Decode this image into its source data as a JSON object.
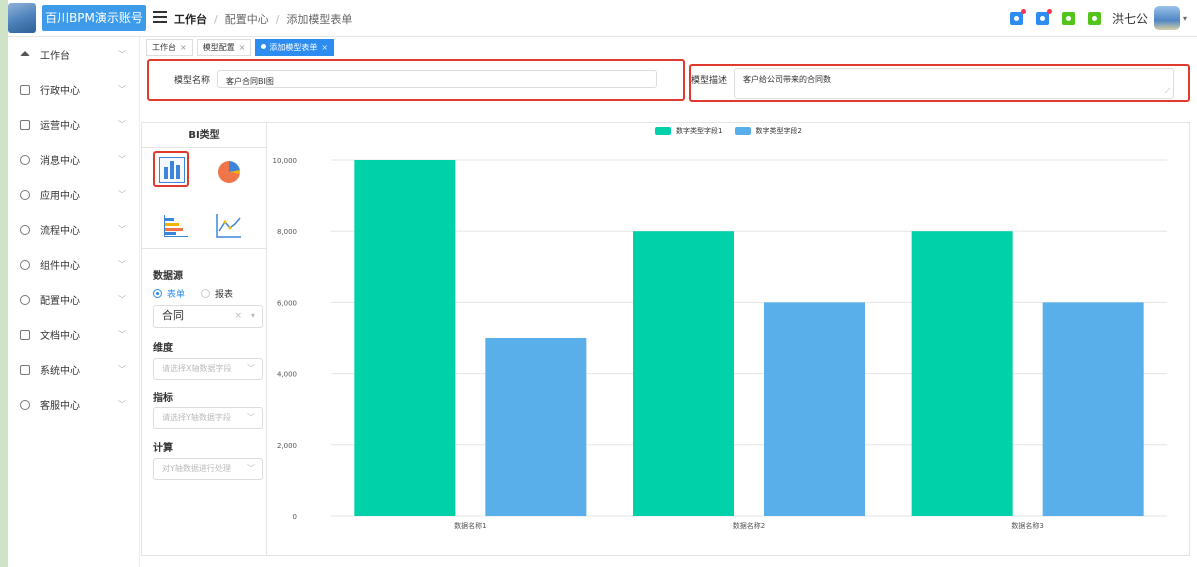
{
  "header": {
    "app_title": "百川BPM演示账号",
    "breadcrumb": [
      "工作台",
      "配置中心",
      "添加模型表单"
    ],
    "user_name": "洪七公",
    "icons": [
      {
        "name": "notice-icon",
        "color": "#2d8cf0",
        "badge": true
      },
      {
        "name": "bell-icon",
        "color": "#2d8cf0",
        "badge": true
      },
      {
        "name": "message-icon",
        "color": "#52c41a",
        "badge": false
      },
      {
        "name": "lock-icon",
        "color": "#52c41a",
        "badge": false
      }
    ]
  },
  "sidebar": {
    "items": [
      {
        "label": "工作台",
        "icon": "home-icon"
      },
      {
        "label": "行政中心",
        "icon": "building-icon"
      },
      {
        "label": "运营中心",
        "icon": "monitor-icon"
      },
      {
        "label": "消息中心",
        "icon": "bell-icon"
      },
      {
        "label": "应用中心",
        "icon": "apps-icon"
      },
      {
        "label": "流程中心",
        "icon": "share-icon"
      },
      {
        "label": "组件中心",
        "icon": "component-icon"
      },
      {
        "label": "配置中心",
        "icon": "gear-icon"
      },
      {
        "label": "文档中心",
        "icon": "folder-icon"
      },
      {
        "label": "系统中心",
        "icon": "desktop-icon"
      },
      {
        "label": "客服中心",
        "icon": "user-icon"
      }
    ]
  },
  "tabs": [
    {
      "label": "工作台",
      "active": false
    },
    {
      "label": "模型配置",
      "active": false
    },
    {
      "label": "添加模型表单",
      "active": true
    }
  ],
  "form": {
    "name_label": "模型名称",
    "name_value": "客户合同BI图",
    "desc_label": "模型描述",
    "desc_value": "客户给公司带来的合同数"
  },
  "bi_panel": {
    "title": "BI类型",
    "chart_types": [
      "bar-chart-icon",
      "pie-chart-icon",
      "horizontal-bar-icon",
      "line-chart-icon"
    ],
    "datasource_label": "数据源",
    "datasource_options": [
      "表单",
      "报表"
    ],
    "datasource_selected": "表单",
    "datasource_value": "合同",
    "dimension_label": "维度",
    "dimension_placeholder": "请选择X轴数据字段",
    "metric_label": "指标",
    "metric_placeholder": "请选择Y轴数据字段",
    "calc_label": "计算",
    "calc_placeholder": "对Y轴数据进行处理"
  },
  "colors": {
    "accent": "#2d8cf0",
    "series1": "#00d1a8",
    "series2": "#58afe9",
    "highlight_border": "#e03a2e"
  },
  "chart_data": {
    "type": "bar",
    "categories": [
      "数据名称1",
      "数据名称2",
      "数据名称3"
    ],
    "series": [
      {
        "name": "数字类型字段1",
        "values": [
          10000,
          8000,
          8000
        ]
      },
      {
        "name": "数字类型字段2",
        "values": [
          5000,
          6000,
          6000
        ]
      }
    ],
    "yticks": [
      "0",
      "2,000",
      "4,000",
      "6,000",
      "8,000",
      "10,000"
    ],
    "ylim": [
      0,
      10000
    ],
    "grid": true,
    "legend": "top-center"
  }
}
